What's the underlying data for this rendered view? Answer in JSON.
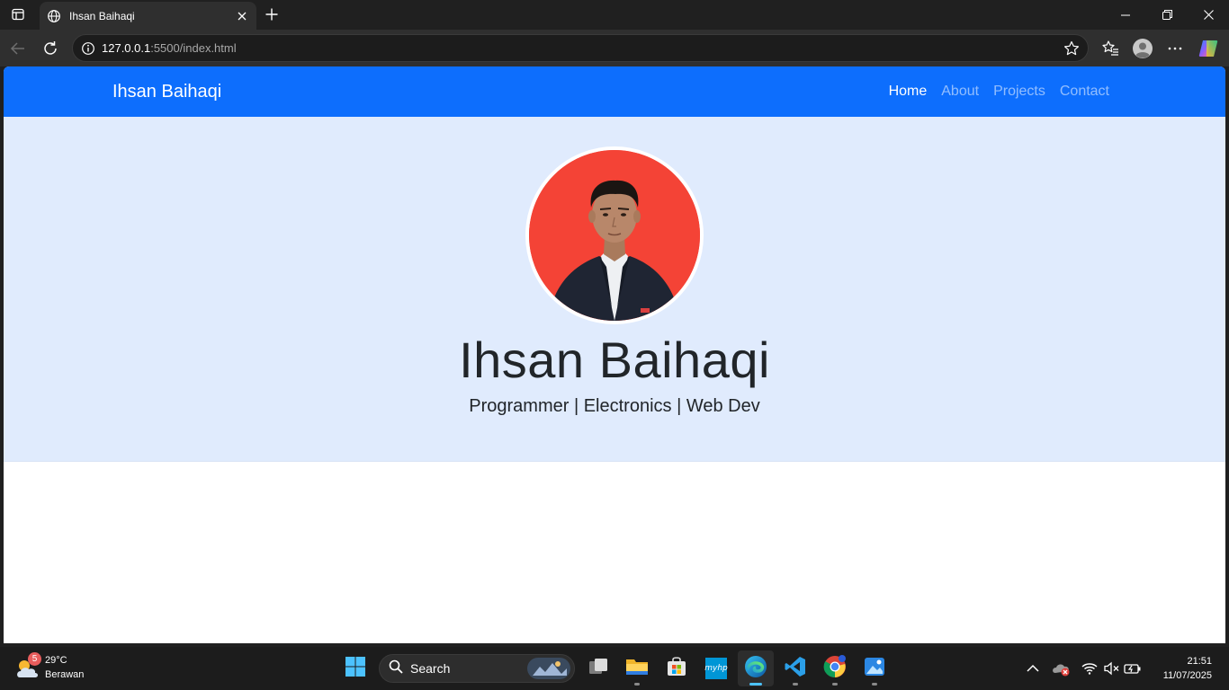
{
  "browser": {
    "tab_title": "Ihsan Baihaqi",
    "url_host": "127.0.0.1",
    "url_rest": ":5500/index.html"
  },
  "site": {
    "brand": "Ihsan Baihaqi",
    "nav": [
      {
        "label": "Home",
        "active": true
      },
      {
        "label": "About",
        "active": false
      },
      {
        "label": "Projects",
        "active": false
      },
      {
        "label": "Contact",
        "active": false
      }
    ],
    "hero": {
      "name": "Ihsan Baihaqi",
      "tagline": "Programmer | Electronics | Web Dev",
      "avatar_bg": "#f44336"
    },
    "colors": {
      "navbar": "#0d6efd",
      "hero_bg": "#e0ebfd"
    }
  },
  "taskbar": {
    "weather": {
      "badge": "5",
      "temperature": "29°C",
      "condition": "Berawan"
    },
    "search_label": "Search",
    "apps": [
      "start-icon",
      "task-view-icon",
      "file-explorer-icon",
      "microsoft-store-icon",
      "myhp-icon",
      "edge-icon",
      "vscode-icon",
      "chrome-icon",
      "photos-icon"
    ],
    "myhp_label": "myhp",
    "clock": {
      "time": "21:51",
      "date": "11/07/2025"
    }
  }
}
